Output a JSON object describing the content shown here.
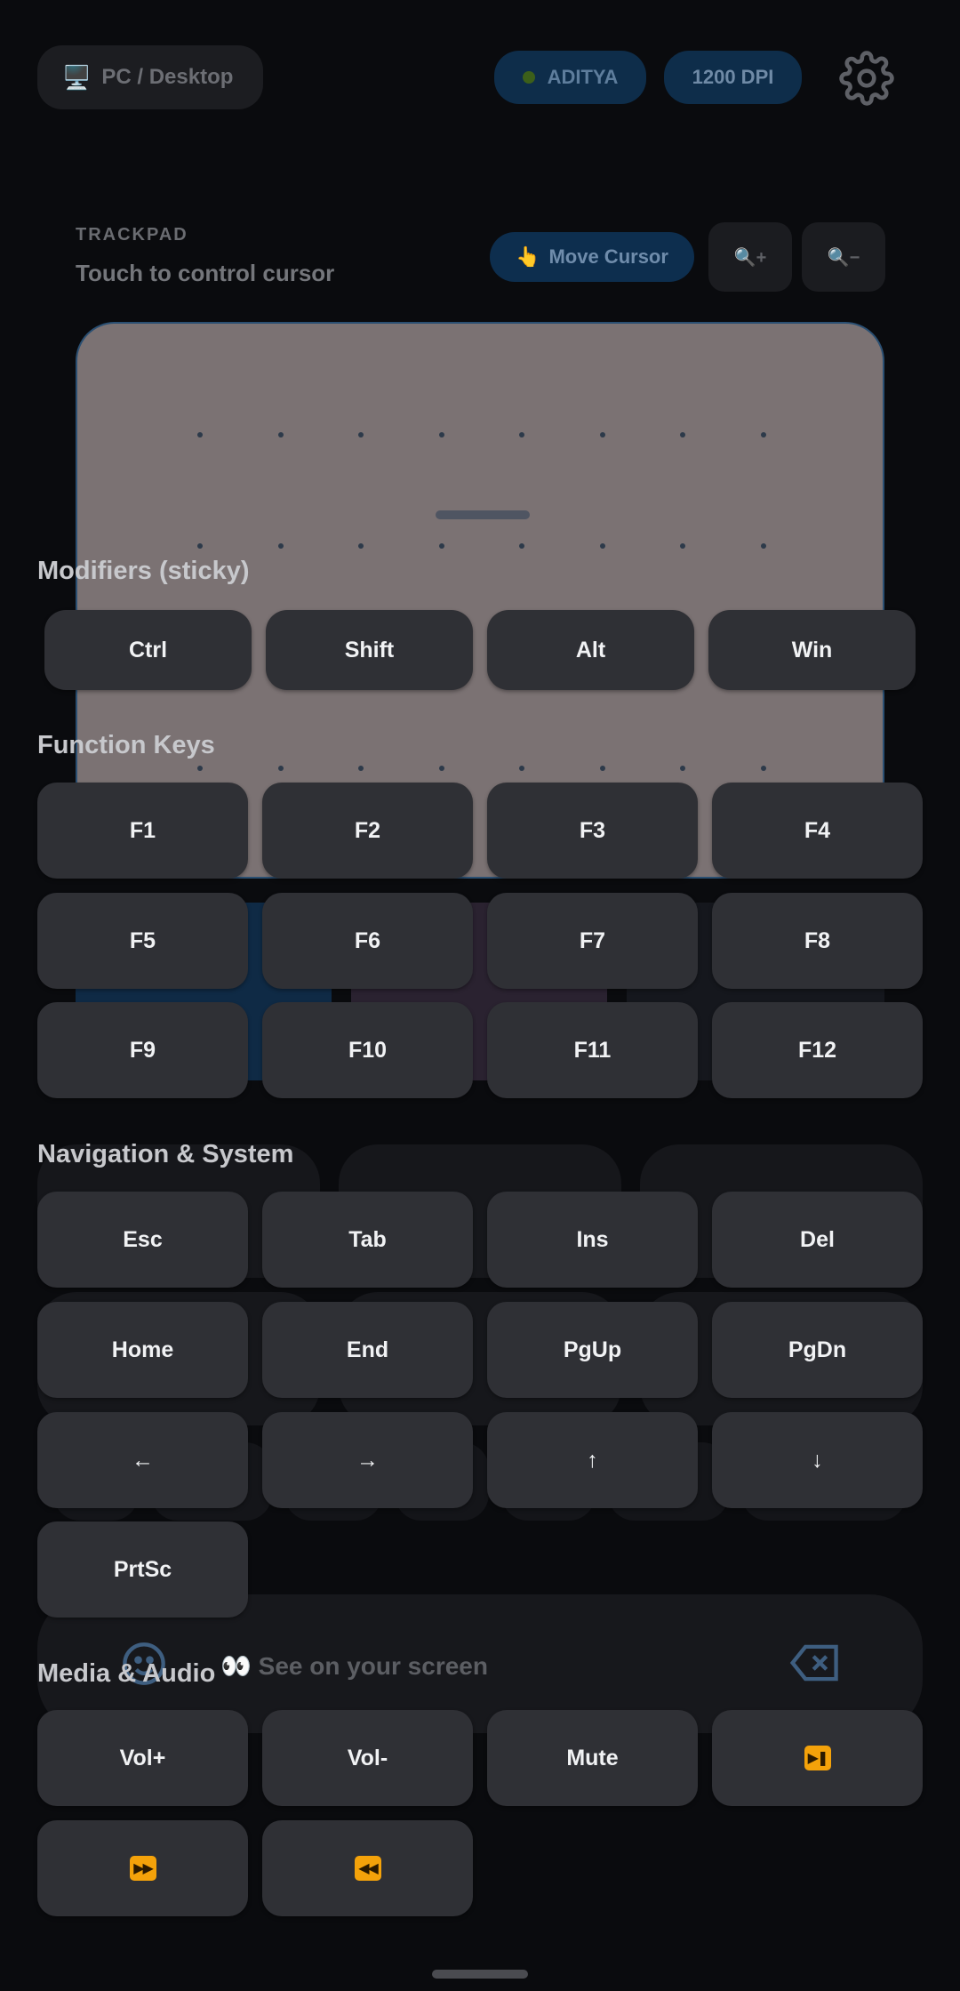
{
  "header": {
    "device_label": "PC / Desktop",
    "user_name": "ADITYA",
    "dpi_label": "1200 DPI"
  },
  "trackpad": {
    "section_label": "TRACKPAD",
    "subtitle": "Touch to control cursor",
    "mode_button": "Move Cursor",
    "zoom_in": "🔍+",
    "zoom_out": "🔍−"
  },
  "typing_bar": {
    "placeholder": "👀 See on your screen"
  },
  "keyboard_sheet": {
    "modifiers_title": "Modifiers (sticky)",
    "modifiers": [
      "Ctrl",
      "Shift",
      "Alt",
      "Win"
    ],
    "function_title": "Function Keys",
    "function_keys": [
      "F1",
      "F2",
      "F3",
      "F4",
      "F5",
      "F6",
      "F7",
      "F8",
      "F9",
      "F10",
      "F11",
      "F12"
    ],
    "navigation_title": "Navigation & System",
    "navigation_keys": [
      "Esc",
      "Tab",
      "Ins",
      "Del",
      "Home",
      "End",
      "PgUp",
      "PgDn",
      "←",
      "→",
      "↑",
      "↓",
      "PrtSc"
    ],
    "media_title": "Media & Audio",
    "media_keys": [
      "Vol+",
      "Vol-",
      "Mute"
    ],
    "media_icons": [
      "play-pause-icon",
      "next-track-icon",
      "previous-track-icon"
    ]
  }
}
